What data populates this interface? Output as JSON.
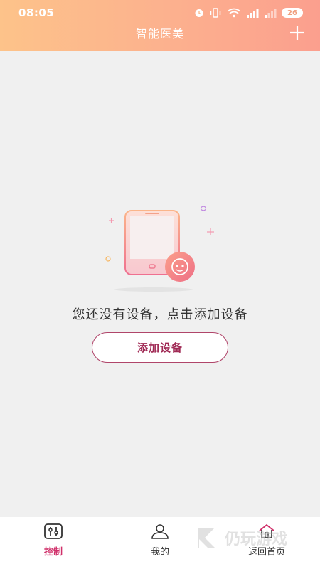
{
  "status_bar": {
    "time": "08:05",
    "battery": "26",
    "icons": [
      "alarm-icon",
      "vibrate-icon",
      "wifi-icon",
      "signal-icon",
      "signal-icon",
      "battery-icon"
    ]
  },
  "header": {
    "title": "智能医美",
    "add_icon": "plus-icon"
  },
  "empty_state": {
    "message": "您还没有设备，点击添加设备",
    "button_label": "添加设备",
    "illustration": "phone-with-device-illustration"
  },
  "tabbar": {
    "tabs": [
      {
        "label": "控制",
        "icon": "sliders-icon",
        "active": true
      },
      {
        "label": "我的",
        "icon": "user-icon",
        "active": false
      },
      {
        "label": "返回首页",
        "icon": "home-icon",
        "active": false
      }
    ]
  },
  "colors": {
    "header_gradient_start": "#fdc38a",
    "header_gradient_end": "#fb9f8e",
    "accent": "#d0306a",
    "button_border": "#b0456a",
    "background": "#f0f0f0"
  }
}
